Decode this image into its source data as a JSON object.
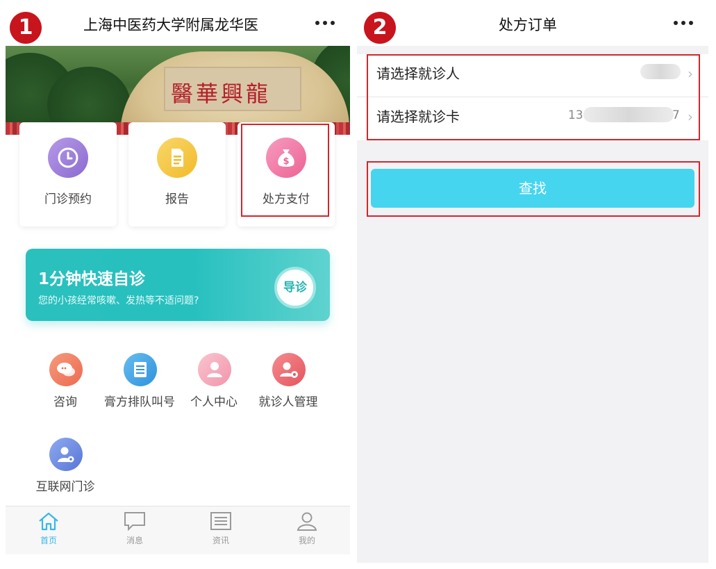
{
  "left": {
    "step_number": "1",
    "title": "上海中医药大学附属龙华医",
    "banner_text": "醫華興龍",
    "cards": [
      {
        "label": "门诊预约",
        "icon": "clock-icon",
        "color": "#9b7fd6"
      },
      {
        "label": "报告",
        "icon": "document-icon",
        "color": "#f4c63e"
      },
      {
        "label": "处方支付",
        "icon": "money-bag-icon",
        "color": "#f07aa6"
      }
    ],
    "promo": {
      "title": "1分钟快速自诊",
      "subtitle": "您的小孩经常咳嗽、发热等不适问题?",
      "button": "导诊"
    },
    "grid": [
      {
        "label": "咨询",
        "icon": "chat-icon",
        "color": "#f07a5c"
      },
      {
        "label": "膏方排队叫号",
        "icon": "list-icon",
        "color": "#3fa6e8"
      },
      {
        "label": "个人中心",
        "icon": "user-icon",
        "color": "#f4a7b9"
      },
      {
        "label": "就诊人管理",
        "icon": "user-settings-icon",
        "color": "#ef6a70"
      },
      {
        "label": "互联网门诊",
        "icon": "doctor-icon",
        "color": "#6b8fe0"
      }
    ],
    "tabs": [
      {
        "label": "首页",
        "icon": "home-icon"
      },
      {
        "label": "消息",
        "icon": "message-icon"
      },
      {
        "label": "资讯",
        "icon": "news-icon"
      },
      {
        "label": "我的",
        "icon": "profile-icon"
      }
    ]
  },
  "right": {
    "step_number": "2",
    "title": "处方订单",
    "rows": [
      {
        "label": "请选择就诊人",
        "value": ""
      },
      {
        "label": "请选择就诊卡",
        "value_prefix": "13",
        "value_suffix": "7"
      }
    ],
    "search_button": "查找"
  },
  "colors": {
    "highlight_box": "#d5242b",
    "step_badge": "#c8141d",
    "search_button": "#46d5ef",
    "active_tab": "#36b8e8"
  }
}
